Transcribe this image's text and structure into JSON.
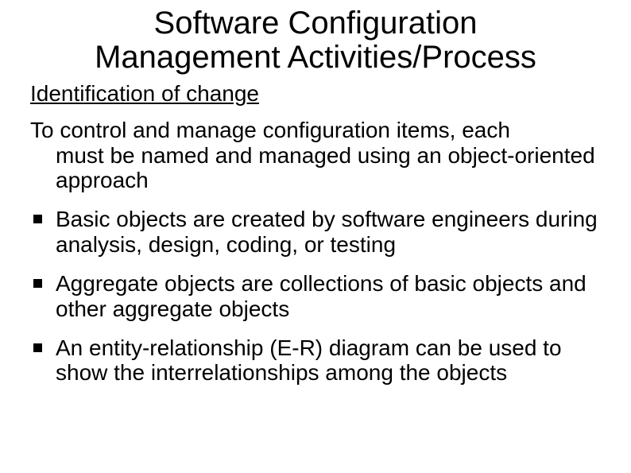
{
  "title_line1": "Software Configuration",
  "title_line2": "Management Activities/Process",
  "subheading": "Identification of change",
  "intro_first": "To control and manage configuration items, each",
  "intro_rest": "must be named and managed using an object-oriented approach",
  "bullets": [
    "Basic objects are created by software engineers during analysis, design, coding, or testing",
    "Aggregate objects are collections of basic objects and other aggregate objects",
    "An entity-relationship (E-R) diagram can be used to show the interrelationships among the objects"
  ]
}
